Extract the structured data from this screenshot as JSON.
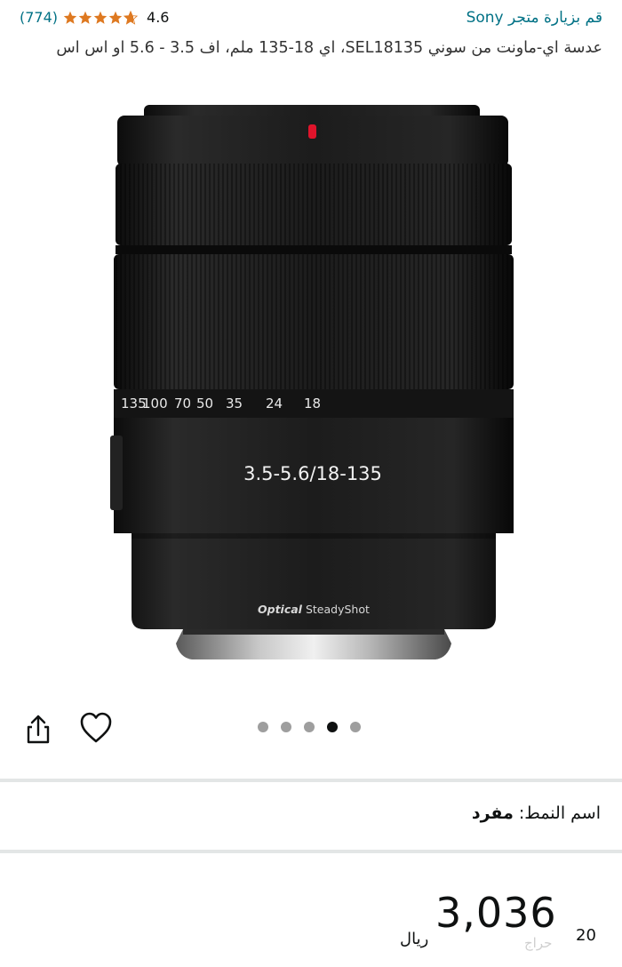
{
  "header": {
    "store_link": "قم بزيارة متجر Sony",
    "rating_score": "4.6",
    "rating_count": "(774)",
    "rating_value": 4.6,
    "title": "عدسة اي-ماونت من سوني SEL18135، اي 18-135 ملم، اف 3.5 - 5.6 او اس اس"
  },
  "product_image": {
    "lens_markings": {
      "focal_scale": [
        "135",
        "100",
        "70",
        "50",
        "35",
        "24",
        "18"
      ],
      "aperture_label": "3.5-5.6/18-135",
      "brand_optical": "Optical",
      "brand_steadyshot": "SteadyShot"
    }
  },
  "carousel": {
    "total": 5,
    "active_index": 3
  },
  "actions": {
    "share_icon": "share-icon",
    "heart_icon": "heart-icon"
  },
  "style": {
    "label": "اسم النمط:",
    "value": "مفرد"
  },
  "price": {
    "currency": "ريال",
    "whole": "3,036",
    "fraction": "20"
  },
  "watermark": "حراج"
}
